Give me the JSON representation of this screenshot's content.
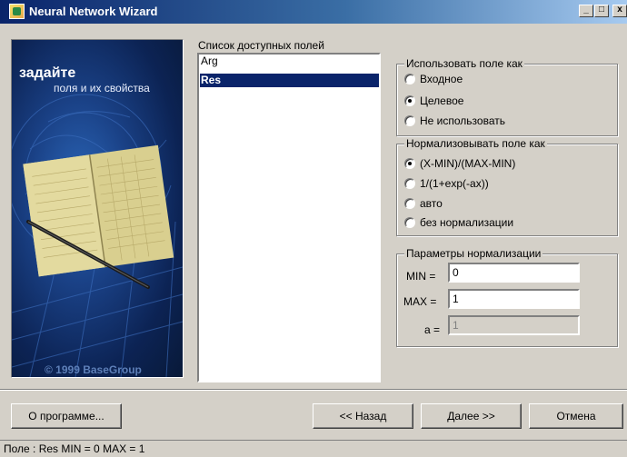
{
  "window": {
    "title": "Neural Network Wizard",
    "minimize_glyph": "_",
    "maximize_glyph": "□",
    "close_glyph": "x"
  },
  "picture": {
    "title": "задайте",
    "subtitle": "поля и их свойства",
    "copyright": "© 1999 BaseGroup"
  },
  "fields": {
    "label": "Список доступных полей",
    "items": [
      {
        "label": "Arg",
        "selected": false
      },
      {
        "label": "Res",
        "selected": true
      }
    ]
  },
  "usage": {
    "legend": "Использовать поле как",
    "options": [
      {
        "label": "Входное",
        "checked": false
      },
      {
        "label": "Целевое",
        "checked": true
      },
      {
        "label": "Не использовать",
        "checked": false
      }
    ]
  },
  "normalization": {
    "legend": "Нормализовывать поле как",
    "options": [
      {
        "label": "(X-MIN)/(MAX-MIN)",
        "checked": true
      },
      {
        "label": "1/(1+exp(-ax))",
        "checked": false
      },
      {
        "label": "авто",
        "checked": false
      },
      {
        "label": "без нормализации",
        "checked": false
      }
    ]
  },
  "params": {
    "legend": "Параметры нормализации",
    "min_label": "MIN =",
    "min_value": "0",
    "max_label": "MAX =",
    "max_value": "1",
    "a_label": "a =",
    "a_value": "1"
  },
  "buttons": {
    "about": "О программе...",
    "back": "<< Назад",
    "next": "Далее >>",
    "cancel": "Отмена"
  },
  "status": {
    "text": "Поле : Res  MIN = 0 MAX = 1"
  }
}
